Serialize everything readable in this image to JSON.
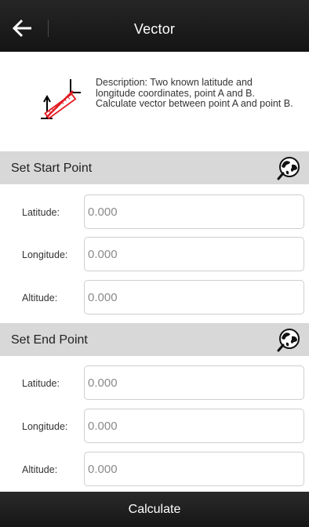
{
  "app_bar": {
    "title": "Vector",
    "back_icon": "arrow-left-icon"
  },
  "description": {
    "icon": "vector-ruler-icon",
    "text": "Description: Two known latitude and longitude coordinates, point A and B. Calculate vector between point A and point B."
  },
  "start_point": {
    "title": "Set Start Point",
    "map_icon": "globe-search-icon",
    "fields": [
      {
        "label": "Latitude:",
        "placeholder": "0.000",
        "value": ""
      },
      {
        "label": "Longitude:",
        "placeholder": "0.000",
        "value": ""
      },
      {
        "label": "Altitude:",
        "placeholder": "0.000",
        "value": ""
      }
    ]
  },
  "end_point": {
    "title": "Set End Point",
    "map_icon": "globe-search-icon",
    "fields": [
      {
        "label": "Latitude:",
        "placeholder": "0.000",
        "value": ""
      },
      {
        "label": "Longitude:",
        "placeholder": "0.000",
        "value": ""
      },
      {
        "label": "Altitude:",
        "placeholder": "0.000",
        "value": ""
      }
    ]
  },
  "actions": {
    "calculate_label": "Calculate"
  },
  "colors": {
    "app_bar": "#1b1b1b",
    "section_header": "#d8d8d8",
    "accent_red": "#e31b23"
  }
}
